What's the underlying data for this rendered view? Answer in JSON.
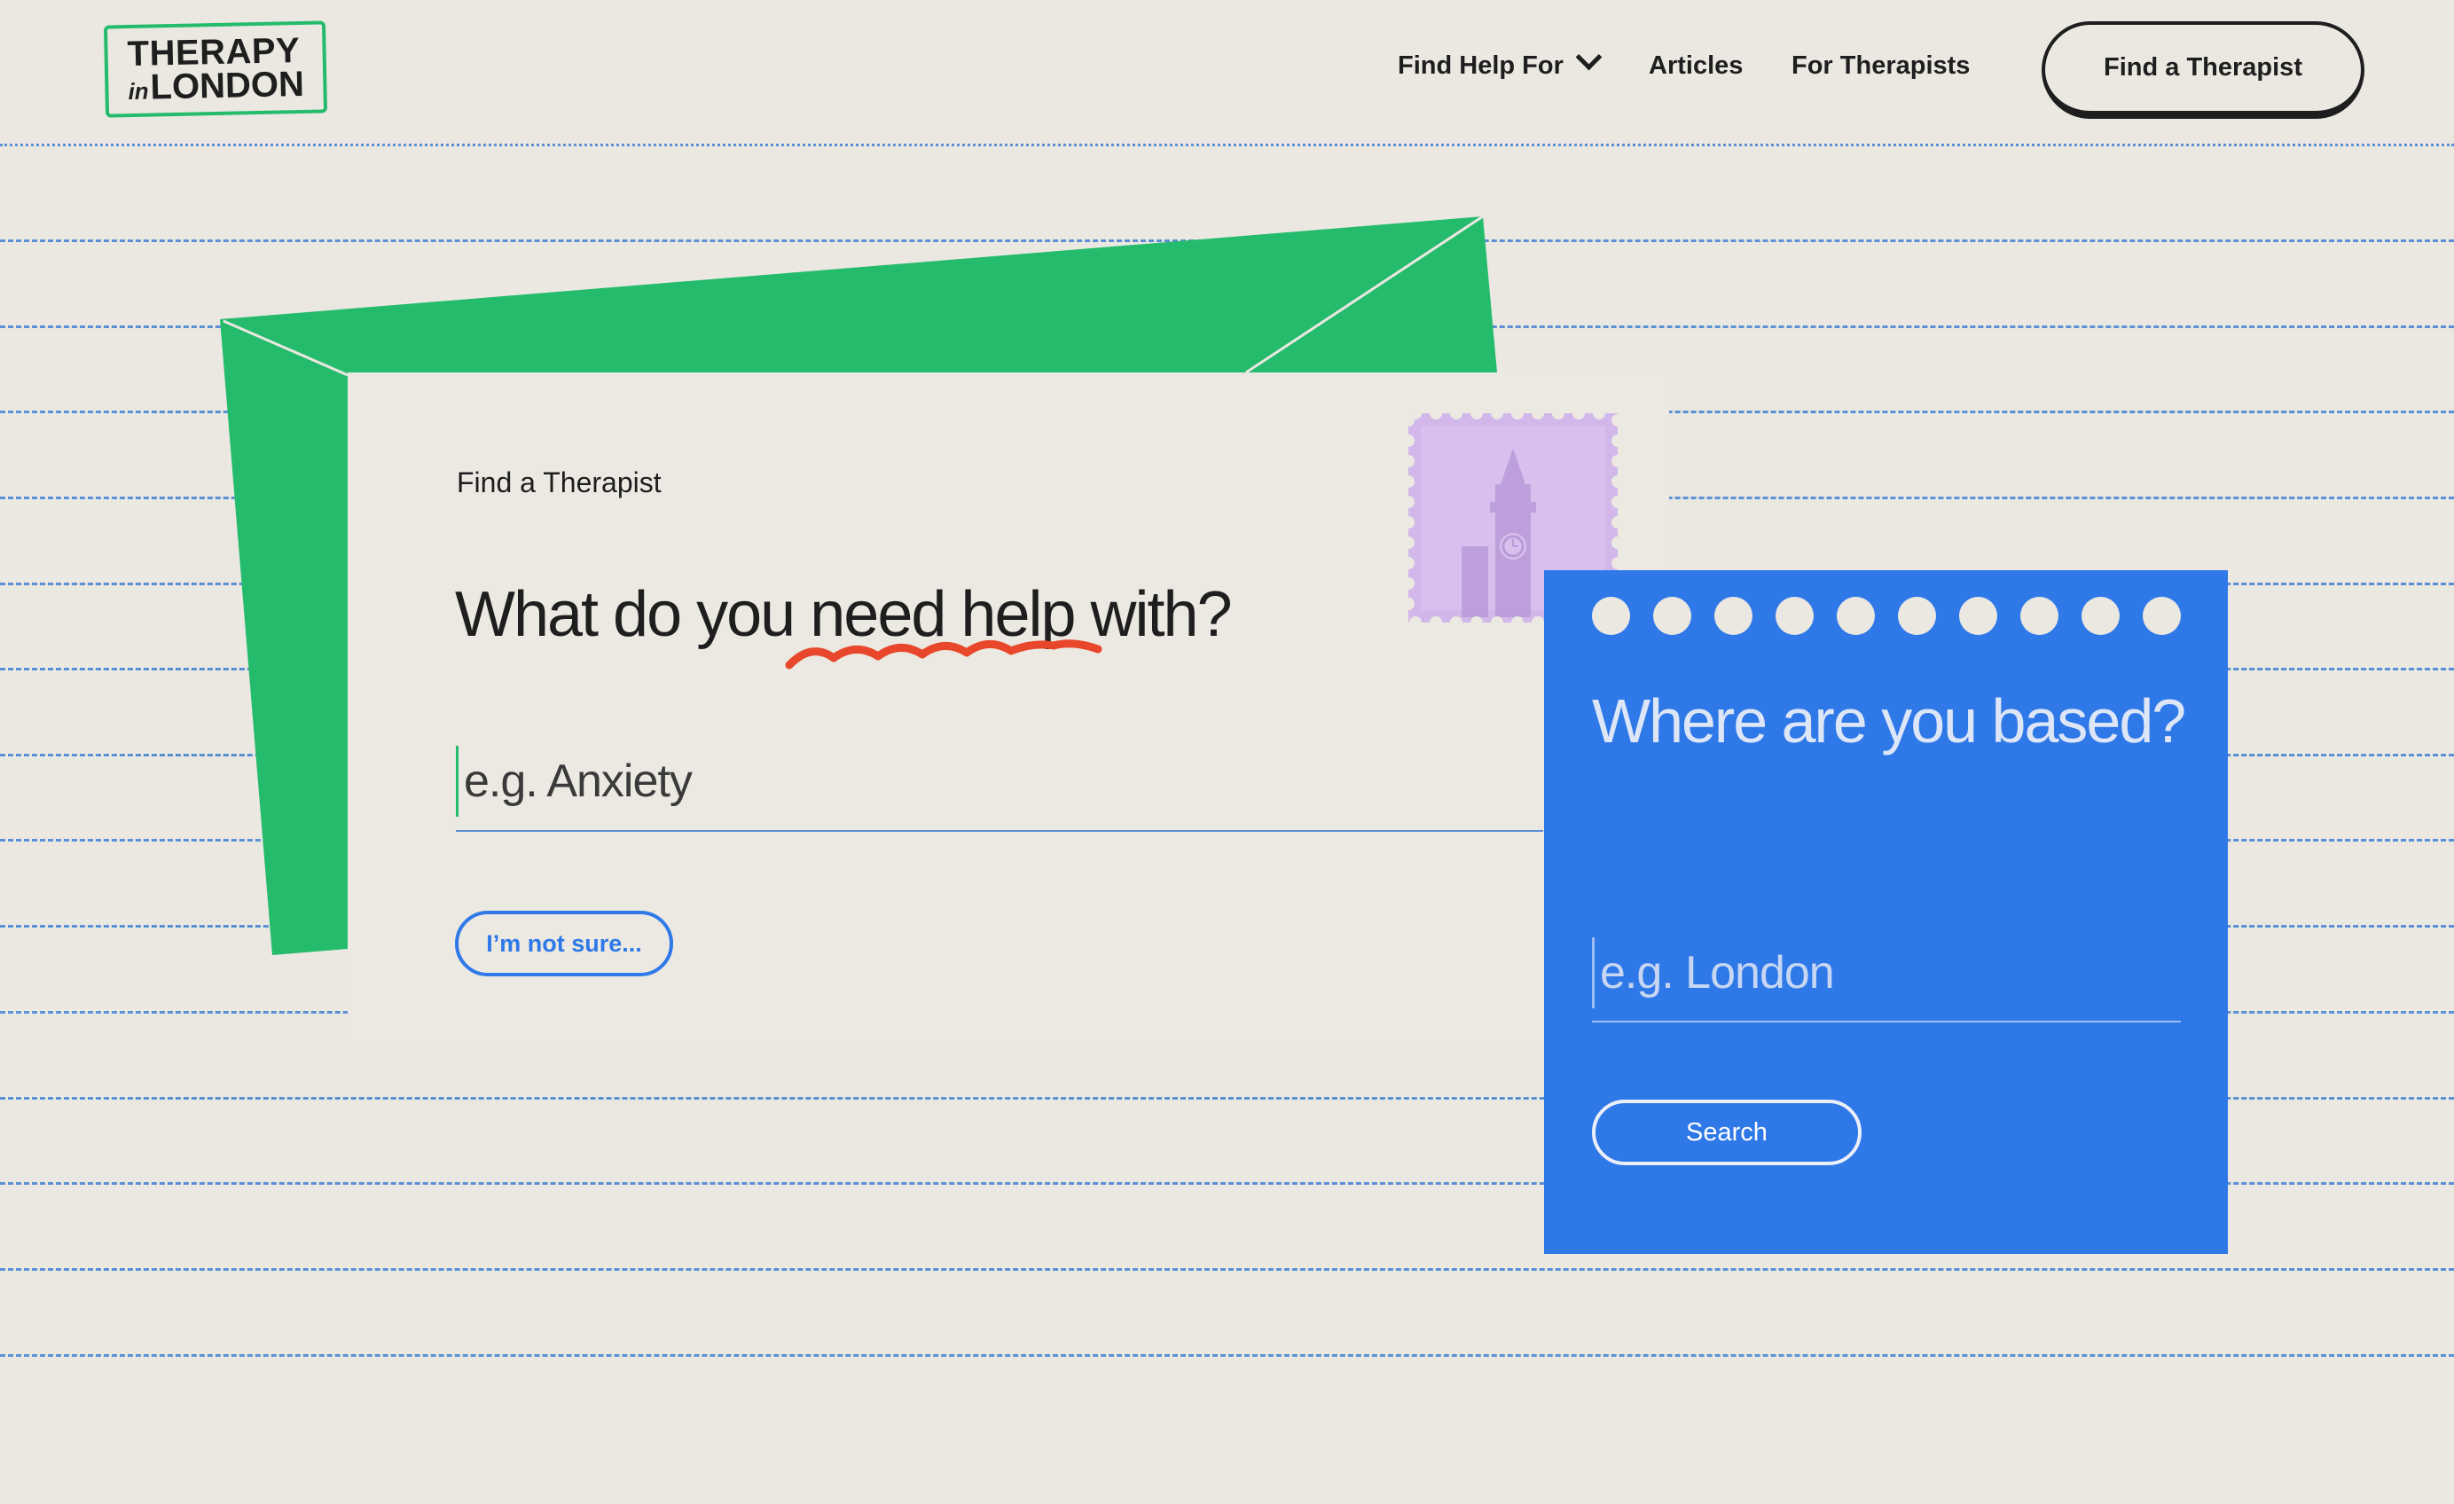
{
  "header": {
    "logo_line1": "THERAPY",
    "logo_in": "in",
    "logo_line2": "LONDON",
    "nav": {
      "find_help_for": "Find Help For",
      "articles": "Articles",
      "for_therapists": "For Therapists"
    },
    "cta_label": "Find a Therapist"
  },
  "main": {
    "eyebrow": "Find a Therapist",
    "headline": "What do you need help with?",
    "help_input": {
      "placeholder": "e.g. Anxiety"
    },
    "not_sure_label": "I’m not sure..."
  },
  "location_card": {
    "title": "Where are you based?",
    "location_input": {
      "placeholder": "e.g. London"
    },
    "search_label": "Search",
    "hole_count": 10
  },
  "colors": {
    "background": "#eae8e1",
    "envelope_green": "#25bb6d",
    "card_blue": "#2f78e8",
    "squiggle_red": "#e8472b",
    "stamp_lilac": "#d2b8ea",
    "rule_blue": "#5b8fd6",
    "text_dark": "#1e1e1e"
  }
}
